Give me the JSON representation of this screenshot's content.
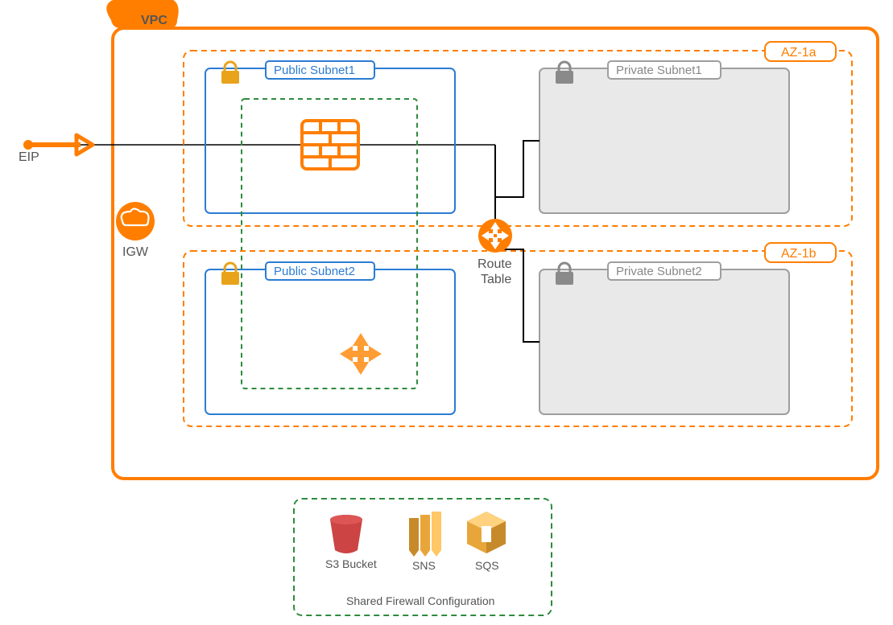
{
  "colors": {
    "orange": "#ff7e00",
    "orange_fill": "#ff9c33",
    "blue": "#2b7cd3",
    "gray_border": "#9e9e9e",
    "gray_fill": "#e9e9e9",
    "green": "#2e8b3d",
    "text": "#555"
  },
  "vpc": {
    "label": "VPC"
  },
  "eip": {
    "label": "EIP"
  },
  "igw": {
    "label": "IGW"
  },
  "az1": {
    "label": "AZ-1a",
    "public_subnet": "Public Subnet1",
    "private_subnet": "Private Subnet1"
  },
  "az2": {
    "label": "AZ-1b",
    "public_subnet": "Public Subnet2",
    "private_subnet": "Private Subnet2"
  },
  "route_table": {
    "label1": "Route",
    "label2": "Table"
  },
  "shared": {
    "title": "Shared Firewall Configuration",
    "s3": "S3 Bucket",
    "sns": "SNS",
    "sqs": "SQS"
  }
}
